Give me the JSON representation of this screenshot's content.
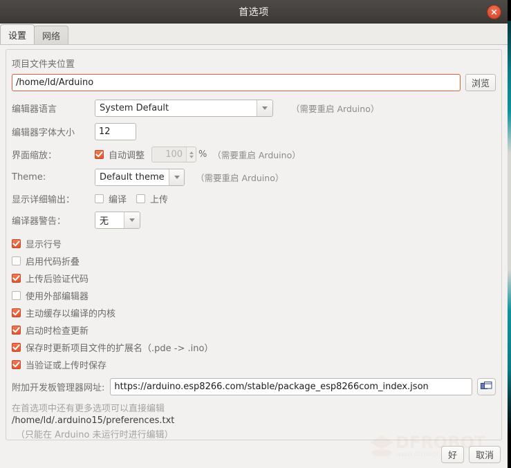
{
  "window": {
    "title": "首选项",
    "close_icon": "close-icon"
  },
  "tabs": [
    {
      "label": "设置",
      "active": true
    },
    {
      "label": "网络",
      "active": false
    }
  ],
  "settings": {
    "sketchbook_label": "项目文件夹位置",
    "sketchbook_path": "/home/ld/Arduino",
    "browse_label": "浏览",
    "language_label": "编辑器语言",
    "language_value": "System Default",
    "language_note": "（需要重启 Arduino）",
    "fontsize_label": "编辑器字体大小",
    "fontsize_value": "12",
    "scale_label": "界面缩放：",
    "scale_auto_label": "自动调整",
    "scale_auto_checked": true,
    "scale_value": "100",
    "scale_percent": "%",
    "scale_note": "（需要重启 Arduino）",
    "theme_label": "Theme:",
    "theme_value": "Default theme",
    "theme_note": "（需要重启 Arduino）",
    "verbose_label": "显示详细输出：",
    "verbose_compile_label": "编译",
    "verbose_compile_checked": false,
    "verbose_upload_label": "上传",
    "verbose_upload_checked": false,
    "warnings_label": "编译器警告：",
    "warnings_value": "无"
  },
  "checkboxes": [
    {
      "label": "显示行号",
      "checked": true
    },
    {
      "label": "启用代码折叠",
      "checked": false
    },
    {
      "label": "上传后验证代码",
      "checked": true
    },
    {
      "label": "使用外部编辑器",
      "checked": false
    },
    {
      "label": "主动缓存以编译的内核",
      "checked": true
    },
    {
      "label": "启动时检查更新",
      "checked": true
    },
    {
      "label": "保存时更新项目文件的扩展名（.pde -> .ino）",
      "checked": true
    },
    {
      "label": "当验证或上传时保存",
      "checked": true
    }
  ],
  "urls": {
    "label": "附加开发板管理器网址:",
    "value": "https://arduino.esp8266.com/stable/package_esp8266com_index.json",
    "button_icon": "windows-icon"
  },
  "footer": {
    "line1": "在首选项中还有更多选项可以直接编辑",
    "line2": "/home/ld/.arduino15/preferences.txt",
    "line3": "（只能在 Arduino 未运行时进行编辑）"
  },
  "actions": {
    "ok": "好",
    "cancel": "取消"
  },
  "watermark": {
    "brand": "DFROBOT",
    "site": "www.dfrobot.com.cn"
  },
  "colors": {
    "accent": "#e2562f",
    "titlebar": "#44413f",
    "focus_border": "#d4623b",
    "desktop_teal": "#10939c"
  }
}
